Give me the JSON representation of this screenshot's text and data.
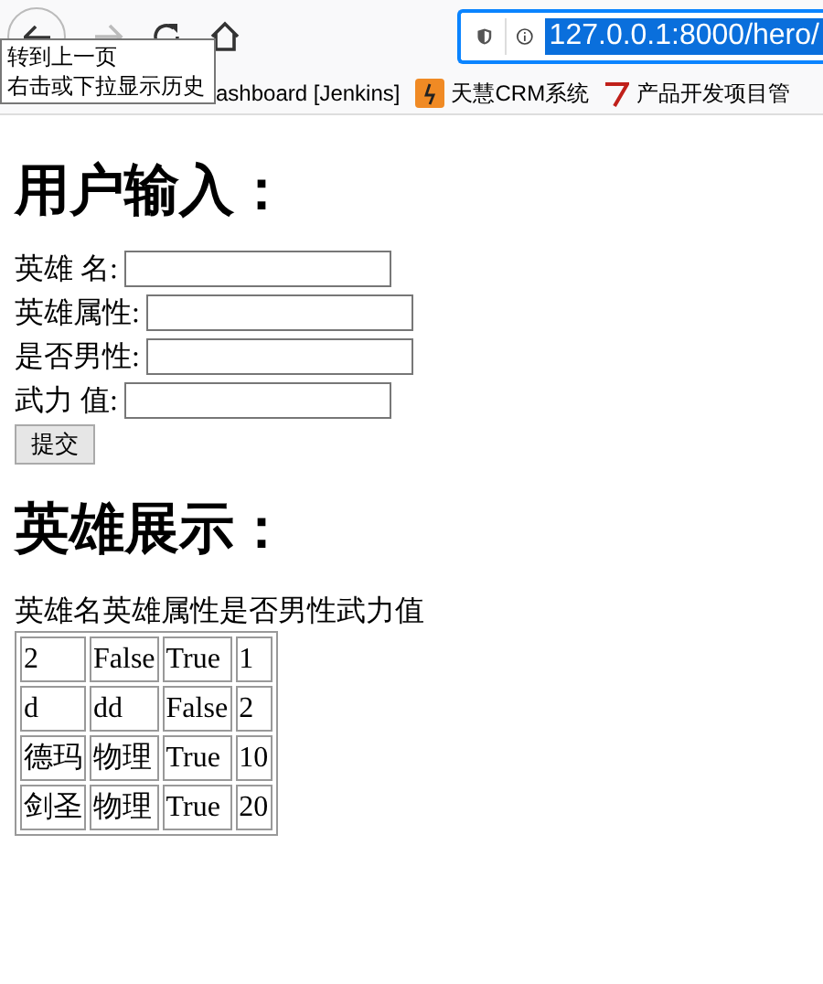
{
  "browser": {
    "url": "127.0.0.1:8000/hero/",
    "url_selected": true,
    "tooltip": [
      "转到上一页",
      "右击或下拉显示历史"
    ],
    "bookmarks": [
      {
        "label": "ashboard [Jenkins]",
        "kind": "plain"
      },
      {
        "label": "天慧CRM系统",
        "kind": "tile"
      },
      {
        "label": "产品开发项目管",
        "kind": "mark"
      }
    ]
  },
  "input_heading": "用户输入：",
  "fields": [
    {
      "label": "英雄 名:"
    },
    {
      "label": "英雄属性:"
    },
    {
      "label": "是否男性:"
    },
    {
      "label": "武力 值:"
    }
  ],
  "submit": "提交",
  "display_heading": "英雄展示：",
  "header_text": "英雄名英雄属性是否男性武力值",
  "rows": [
    [
      "2",
      "False",
      "True",
      "1"
    ],
    [
      "d",
      "dd",
      "False",
      "2"
    ],
    [
      "德玛",
      "物理",
      "True",
      "10"
    ],
    [
      "剑圣",
      "物理",
      "True",
      "20"
    ]
  ]
}
